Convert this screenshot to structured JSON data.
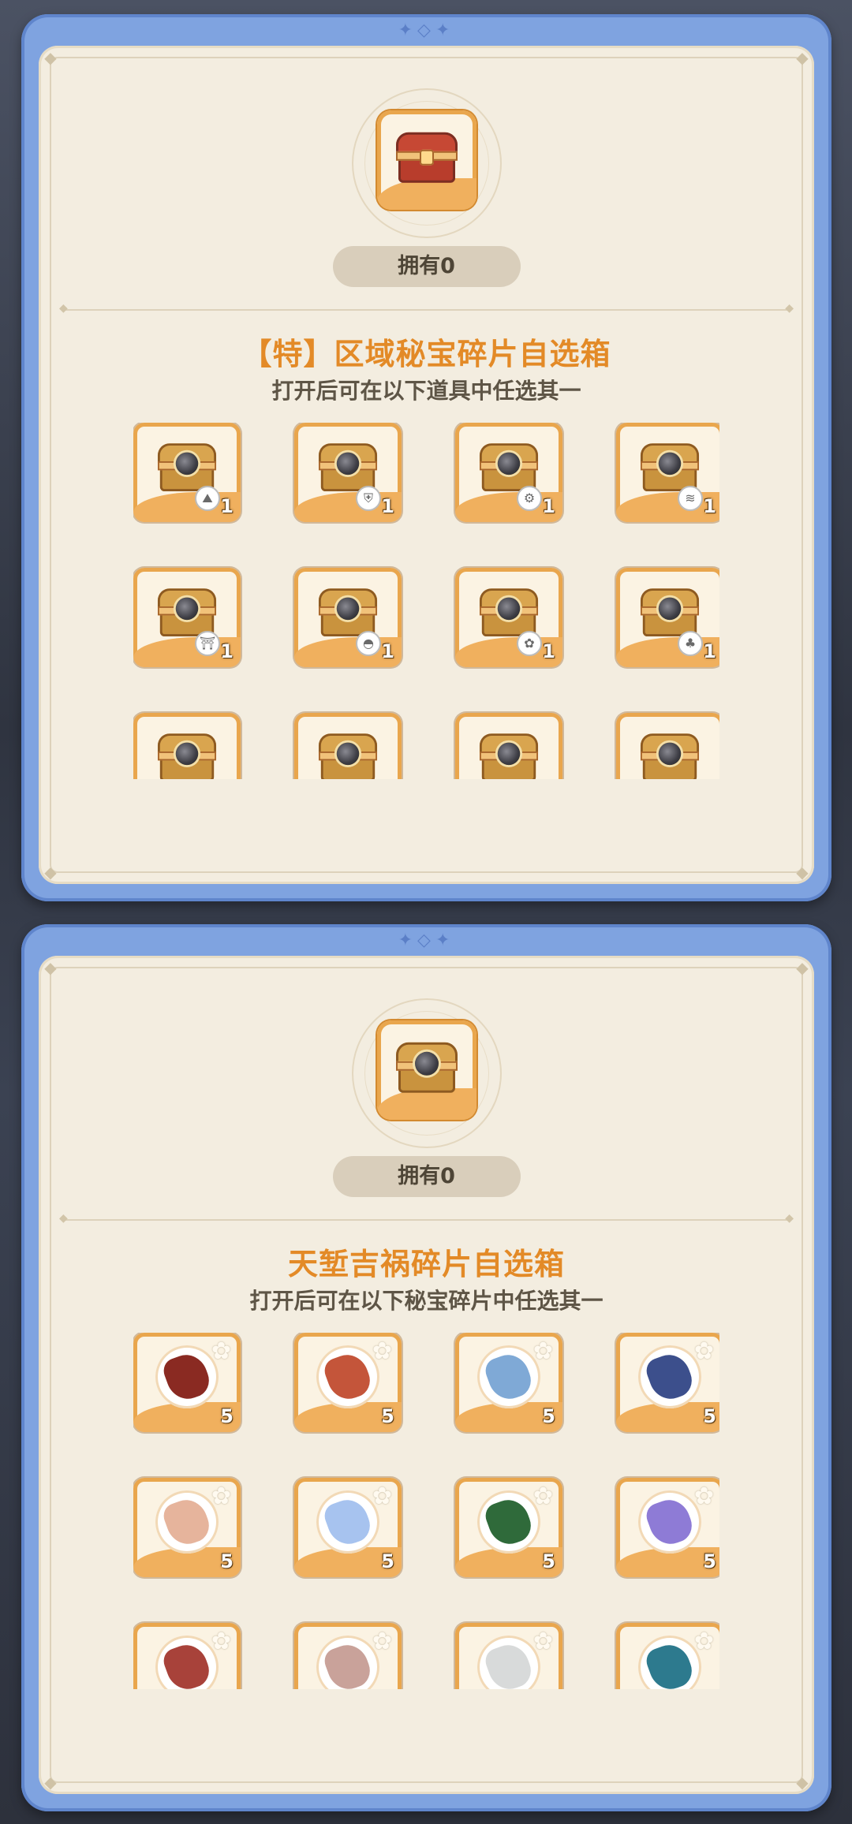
{
  "panels": [
    {
      "owned_label": "拥有0",
      "title": "【特】区域秘宝碎片自选箱",
      "subtitle": "打开后可在以下道具中任选其一",
      "hero_icon": "red-treasure-chest-icon",
      "items": [
        {
          "icon": "golden-chest-icon",
          "badge": "mountain-icon",
          "badge_glyph": "⛰",
          "qty": "1"
        },
        {
          "icon": "golden-chest-icon",
          "badge": "shield-icon",
          "badge_glyph": "⛨",
          "qty": "1"
        },
        {
          "icon": "golden-chest-icon",
          "badge": "gear-icon",
          "badge_glyph": "⚙",
          "qty": "1"
        },
        {
          "icon": "golden-chest-icon",
          "badge": "wave-icon",
          "badge_glyph": "≋",
          "qty": "1"
        },
        {
          "icon": "golden-chest-icon",
          "badge": "gate-icon",
          "badge_glyph": "⛩",
          "qty": "1"
        },
        {
          "icon": "golden-chest-icon",
          "badge": "hat-icon",
          "badge_glyph": "◓",
          "qty": "1"
        },
        {
          "icon": "golden-chest-icon",
          "badge": "leaf-icon",
          "badge_glyph": "✿",
          "qty": "1"
        },
        {
          "icon": "golden-chest-icon",
          "badge": "tree-icon",
          "badge_glyph": "♣",
          "qty": "1"
        },
        {
          "icon": "golden-chest-icon",
          "badge": "",
          "badge_glyph": "",
          "qty": ""
        },
        {
          "icon": "golden-chest-icon",
          "badge": "",
          "badge_glyph": "",
          "qty": ""
        },
        {
          "icon": "golden-chest-icon",
          "badge": "",
          "badge_glyph": "",
          "qty": ""
        },
        {
          "icon": "golden-chest-icon",
          "badge": "",
          "badge_glyph": "",
          "qty": ""
        }
      ]
    },
    {
      "owned_label": "拥有0",
      "title": "天堑吉祸碎片自选箱",
      "subtitle": "打开后可在以下秘宝碎片中任选其一",
      "hero_icon": "golden-chest-mountain-icon",
      "items": [
        {
          "icon": "relic-fragment-icon",
          "color": "#8a2a22",
          "qty": "5"
        },
        {
          "icon": "relic-fragment-icon",
          "color": "#c4553a",
          "qty": "5"
        },
        {
          "icon": "relic-fragment-icon",
          "color": "#7fa9d6",
          "qty": "5"
        },
        {
          "icon": "relic-fragment-icon",
          "color": "#3c4f8c",
          "qty": "5"
        },
        {
          "icon": "relic-fragment-icon",
          "color": "#e6b49c",
          "qty": "5"
        },
        {
          "icon": "relic-fragment-icon",
          "color": "#a7c3ef",
          "qty": "5"
        },
        {
          "icon": "relic-fragment-icon",
          "color": "#2f6a3a",
          "qty": "5"
        },
        {
          "icon": "relic-fragment-icon",
          "color": "#8e7bd6",
          "qty": "5"
        },
        {
          "icon": "relic-fragment-icon",
          "color": "#a8423a",
          "qty": ""
        },
        {
          "icon": "relic-fragment-icon",
          "color": "#c9a29a",
          "qty": ""
        },
        {
          "icon": "relic-fragment-icon",
          "color": "#d8dada",
          "qty": ""
        },
        {
          "icon": "relic-fragment-icon",
          "color": "#2d7a8e",
          "qty": ""
        }
      ]
    }
  ]
}
